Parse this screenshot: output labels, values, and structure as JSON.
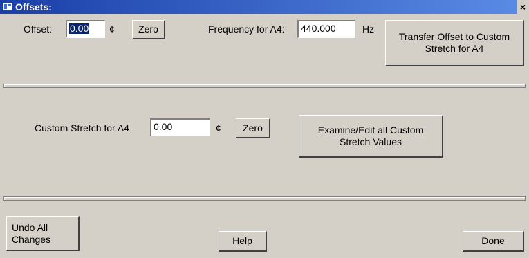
{
  "window": {
    "title": "Offsets:",
    "close_glyph": "×"
  },
  "offset": {
    "label": "Offset:",
    "value": "0.00",
    "unit": "¢",
    "zero_label": "Zero"
  },
  "frequency": {
    "label": "Frequency for A4:",
    "value": "440.000",
    "unit": "Hz"
  },
  "transfer_button": {
    "line1": "Transfer Offset to Custom",
    "line2": "Stretch for A4"
  },
  "custom_stretch": {
    "label": "Custom Stretch for A4",
    "value": "0.00",
    "unit": "¢",
    "zero_label": "Zero"
  },
  "examine_button": {
    "line1": "Examine/Edit all Custom",
    "line2": "Stretch Values"
  },
  "footer": {
    "undo_line1": "Undo All",
    "undo_line2": "Changes",
    "help_label": "Help",
    "done_label": "Done"
  },
  "icons": {
    "app": "app-window-icon",
    "close": "close-icon"
  }
}
